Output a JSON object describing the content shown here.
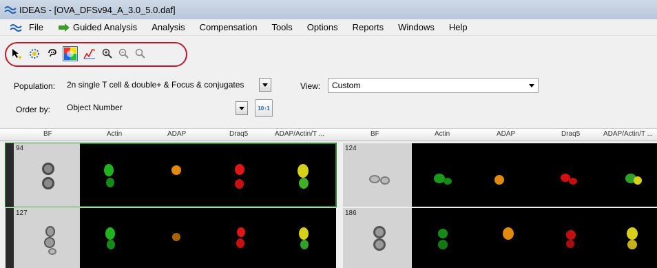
{
  "window": {
    "title": "IDEAS - [OVA_DFSv94_A_3.0_5.0.daf]"
  },
  "menu": [
    "File",
    "Guided Analysis",
    "Analysis",
    "Compensation",
    "Tools",
    "Options",
    "Reports",
    "Windows",
    "Help"
  ],
  "toolbar": {
    "icons": [
      "pointer-icon",
      "spot-icon",
      "lasso-icon",
      "color-wheel-icon",
      "line-plot-icon",
      "zoom-in-icon",
      "zoom-out-icon",
      "zoom-reset-icon"
    ],
    "selected": "color-wheel-icon"
  },
  "population": {
    "label": "Population:",
    "value": "2n single T cell & double+ & Focus & conjugates"
  },
  "view": {
    "label": "View:",
    "value": "Custom"
  },
  "order": {
    "label": "Order by:",
    "value": "Object Number",
    "sort_icon_text": "10↑1"
  },
  "columns_left": [
    "BF",
    "Actin",
    "ADAP",
    "Draq5",
    "ADAP/Actin/T ..."
  ],
  "columns_right": [
    "BF",
    "Actin",
    "ADAP",
    "Draq5",
    "ADAP/Actin/T ..."
  ],
  "objects": [
    {
      "number": "94",
      "selected": true
    },
    {
      "number": "124",
      "selected": false
    },
    {
      "number": "127",
      "selected": false
    },
    {
      "number": "186",
      "selected": false
    }
  ],
  "colors": {
    "selection": "#2e8b2e",
    "highlight_ring": "#c0192b",
    "actin": "#1fb31f",
    "adap": "#e08a10",
    "draq5": "#e01515"
  }
}
